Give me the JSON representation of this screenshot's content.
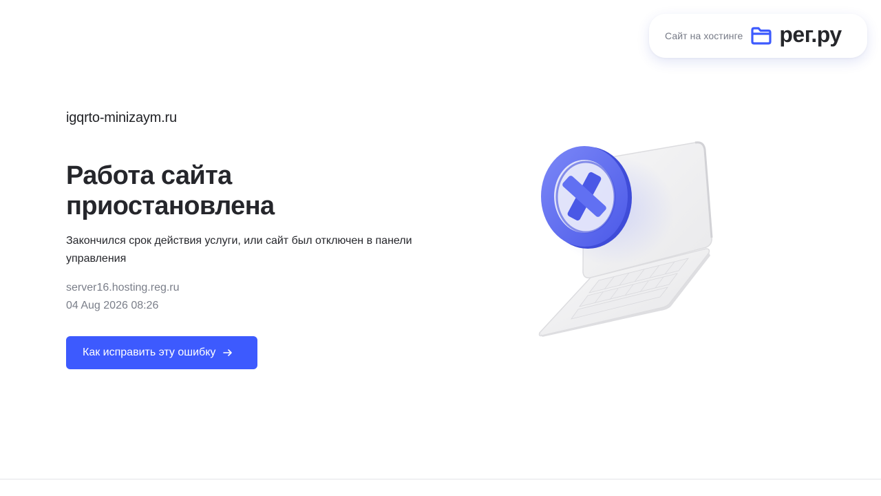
{
  "badge": {
    "label": "Сайт на хостинге",
    "logo_text": "рег.ру",
    "logo_icon": "folder-icon",
    "accent_color": "#3d5afe"
  },
  "main": {
    "domain": "igqrto-minizaym.ru",
    "title_line1": "Работа сайта",
    "title_line2": "приостановлена",
    "description": "Закончился срок действия услуги, или сайт был отключен в панели управления",
    "server": "server16.hosting.reg.ru",
    "timestamp": "04 Aug 2026 08:26",
    "button_label": "Как исправить эту ошибку",
    "button_icon": "arrow-right-icon",
    "button_color": "#3d5afe"
  },
  "illustration": {
    "subject": "laptop with error mark",
    "error_icon": "x-circle-icon",
    "error_color": "#5b6af0"
  }
}
